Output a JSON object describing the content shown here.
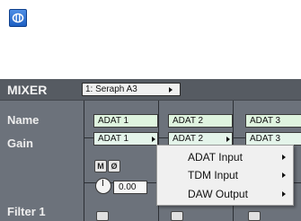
{
  "top_icon": {
    "name": "device-icon"
  },
  "mixer": {
    "title": "MIXER",
    "preset_value": "1: Seraph A3"
  },
  "rows": {
    "name_label": "Name",
    "gain_label": "Gain",
    "filter_label": "Filter 1"
  },
  "channels": [
    {
      "name": "ADAT 1",
      "route": "ADAT 1",
      "gain": "0.00"
    },
    {
      "name": "ADAT 2",
      "route": "ADAT 2"
    },
    {
      "name": "ADAT 3",
      "route": "ADAT 3"
    }
  ],
  "buttons": {
    "mute": "M",
    "phase": "Ø"
  },
  "context_menu": {
    "items": [
      {
        "label": "ADAT Input"
      },
      {
        "label": "TDM Input"
      },
      {
        "label": "DAW Output"
      }
    ]
  }
}
